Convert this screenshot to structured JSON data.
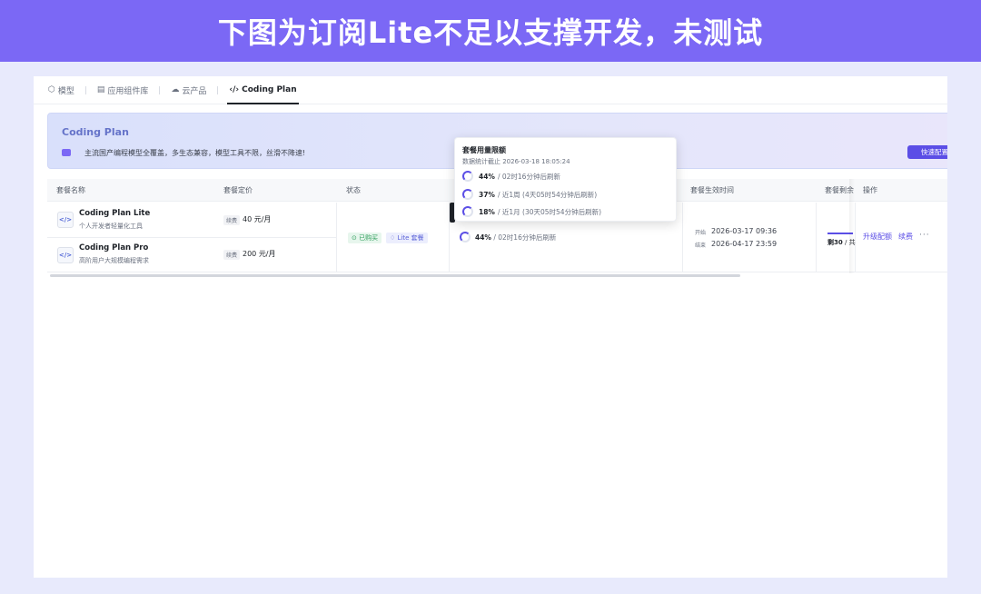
{
  "banner": {
    "text": "下图为订阅Lite不足以支撑开发，未测试"
  },
  "tabs": [
    {
      "label": "模型",
      "icon": "cube-icon"
    },
    {
      "label": "应用组件库",
      "icon": "grid-icon"
    },
    {
      "label": "云产品",
      "icon": "cloud-icon"
    },
    {
      "label": "Coding Plan",
      "icon": "code-icon",
      "active": true
    }
  ],
  "hero": {
    "title": "Coding Plan",
    "description": "主流国产编程模型全覆盖，多生态兼容，模型工具不限，丝滑不降速!",
    "button": "快速配置"
  },
  "table": {
    "headers": [
      "套餐名称",
      "套餐定价",
      "状态",
      "套餐生效时间",
      "套餐剩余",
      "操作"
    ],
    "plans": [
      {
        "name": "Coding Plan Lite",
        "desc": "个人开发者轻量化工具",
        "price_tag": "续费",
        "price": "40 元/月"
      },
      {
        "name": "Coding Plan Pro",
        "desc": "高阶用户大规模编程需求",
        "price_tag": "续费",
        "price": "200 元/月"
      }
    ],
    "status": {
      "purchased": "已购买",
      "tier": "Lite 套餐"
    },
    "usage_main": {
      "percent": "44%",
      "text": "/ 02时16分钟后刷新"
    },
    "effective": {
      "start_label": "开始",
      "start": "2026-03-17 09:36",
      "end_label": "结束",
      "end": "2026-04-17 23:59"
    },
    "remaining": {
      "bold": "剩30",
      "rest": "/ 共"
    },
    "actions": {
      "upgrade": "升级配额",
      "renew": "续费",
      "more": "···"
    }
  },
  "popover": {
    "title": "套餐用量限额",
    "subtitle": "数据统计截止 2026-03-18 18:05:24",
    "rows": [
      {
        "percent": "44%",
        "text": "/ 02时16分钟后刷新",
        "fill": 0.44
      },
      {
        "percent": "37%",
        "text": "/ 近1周 (4天05时54分钟后刷新)",
        "fill": 0.37
      },
      {
        "percent": "18%",
        "text": "/ 近1月 (30天05时54分钟后刷新)",
        "fill": 0.18
      }
    ]
  }
}
